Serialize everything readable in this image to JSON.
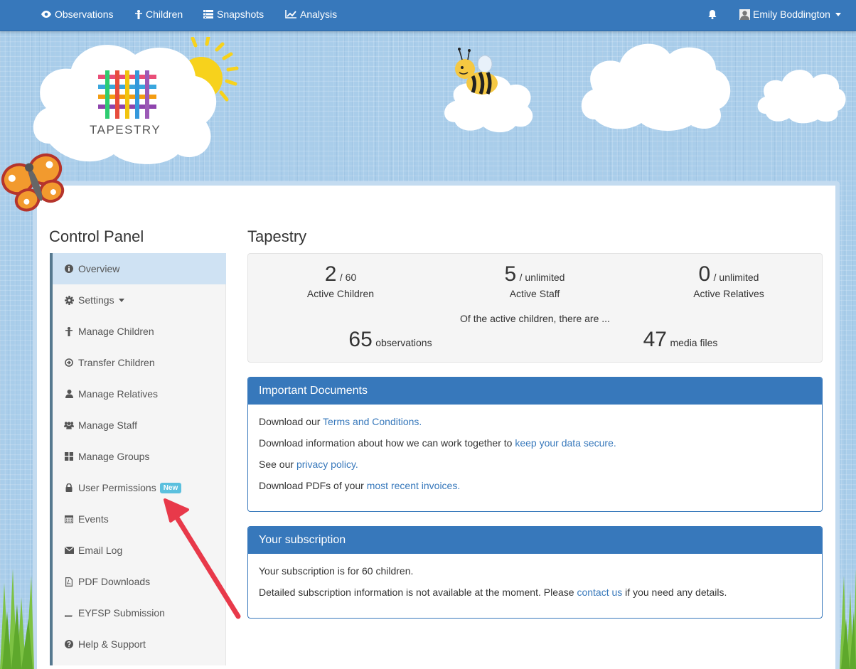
{
  "nav": {
    "items": [
      {
        "label": "Observations",
        "icon": "eye-icon"
      },
      {
        "label": "Children",
        "icon": "child-icon"
      },
      {
        "label": "Snapshots",
        "icon": "list-icon"
      },
      {
        "label": "Analysis",
        "icon": "line-chart-icon"
      }
    ],
    "user_name": "Emily Boddington"
  },
  "logo": {
    "text": "TAPESTRY"
  },
  "sidebar": {
    "title": "Control Panel",
    "items": [
      {
        "label": "Overview",
        "icon": "info-circle-icon"
      },
      {
        "label": "Settings",
        "icon": "gear-icon"
      },
      {
        "label": "Manage Children",
        "icon": "child-icon"
      },
      {
        "label": "Transfer Children",
        "icon": "arrow-circle-icon"
      },
      {
        "label": "Manage Relatives",
        "icon": "user-icon"
      },
      {
        "label": "Manage Staff",
        "icon": "users-icon"
      },
      {
        "label": "Manage Groups",
        "icon": "grid-icon"
      },
      {
        "label": "User Permissions",
        "icon": "lock-icon",
        "badge": "New"
      },
      {
        "label": "Events",
        "icon": "calendar-icon"
      },
      {
        "label": "Email Log",
        "icon": "envelope-icon"
      },
      {
        "label": "PDF Downloads",
        "icon": "pdf-file-icon"
      },
      {
        "label": "EYFSP Submission",
        "icon": "book-icon"
      },
      {
        "label": "Help & Support",
        "icon": "question-circle-icon"
      }
    ]
  },
  "main": {
    "title": "Tapestry",
    "stats": {
      "children": {
        "value": "2",
        "of": "/ 60",
        "label": "Active Children"
      },
      "staff": {
        "value": "5",
        "of": "/ unlimited",
        "label": "Active Staff"
      },
      "relatives": {
        "value": "0",
        "of": "/ unlimited",
        "label": "Active Relatives"
      },
      "note": "Of the active children, there are ...",
      "observations": {
        "value": "65",
        "label": "observations"
      },
      "media": {
        "value": "47",
        "label": "media files"
      }
    },
    "documents": {
      "title": "Important Documents",
      "line1_pre": "Download our ",
      "line1_link": "Terms and Conditions.",
      "line2_pre": "Download information about how we can work together to ",
      "line2_link": "keep your data secure.",
      "line3_pre": "See our ",
      "line3_link": "privacy policy.",
      "line4_pre": "Download PDFs of your ",
      "line4_link": "most recent invoices."
    },
    "subscription": {
      "title": "Your subscription",
      "line1": "Your subscription is for 60 children.",
      "line2_pre": "Detailed subscription information is not available at the moment. Please ",
      "line2_link": "contact us",
      "line2_post": " if you need any details."
    }
  },
  "colors": {
    "brand": "#3778bb",
    "badge": "#5bc0de",
    "arrow": "#e8394a"
  }
}
